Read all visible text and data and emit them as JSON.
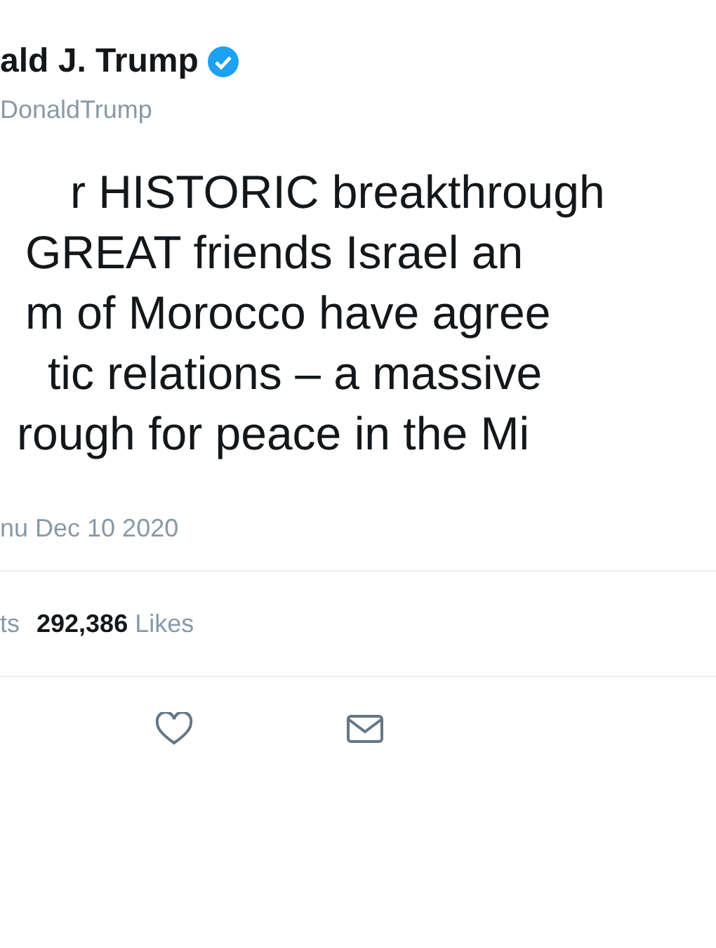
{
  "author": {
    "name": "ald J. Trump",
    "verified": true,
    "handle": "DonaldTrump"
  },
  "tweet_lines": [
    "r HISTORIC breakthrough",
    "GREAT friends Israel an",
    "m of Morocco have agree",
    "tic relations – a massive",
    "rough for peace in the Mi"
  ],
  "timestamp": "nu Dec 10 2020",
  "stats": [
    {
      "label": "ts"
    },
    {
      "count": "292,386",
      "label": "Likes"
    }
  ]
}
